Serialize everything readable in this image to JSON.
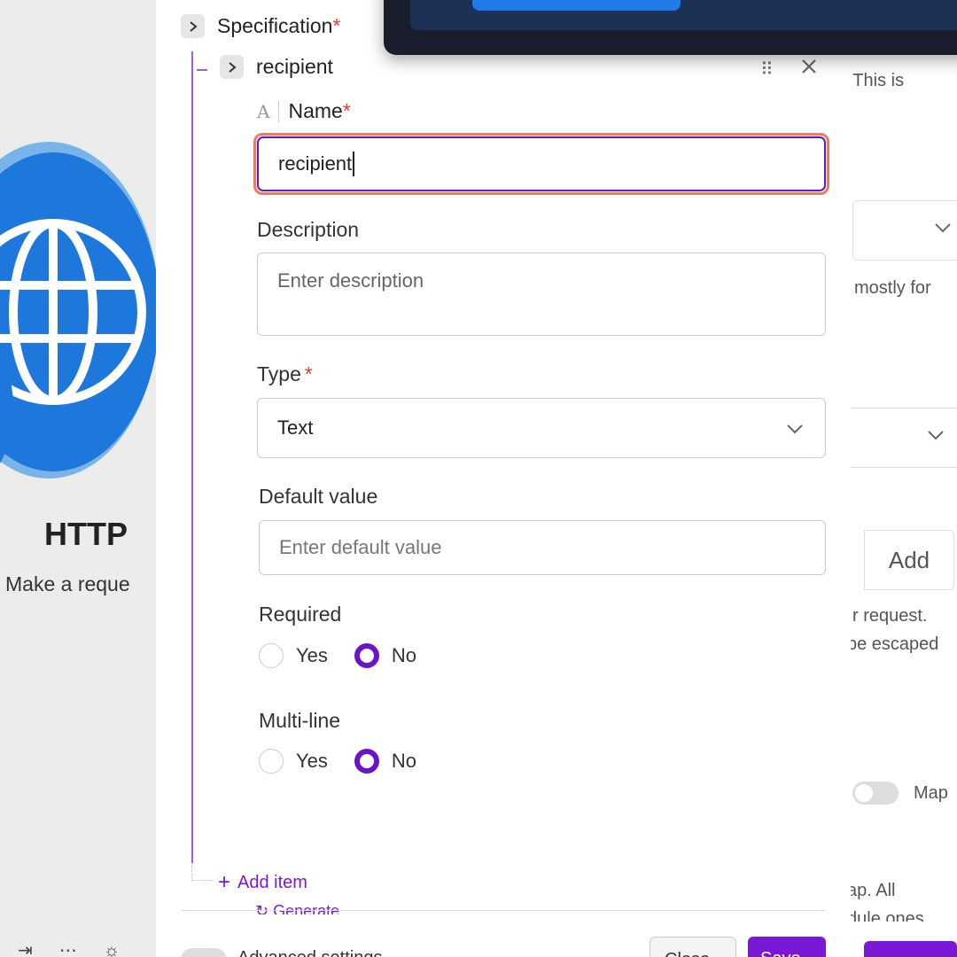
{
  "background": {
    "module_title": "HTTP",
    "module_subtitle": "Make a reque",
    "right_texts": {
      "t1": "t. This is",
      "t2": "mostly for",
      "t3": "r request.",
      "t4": "be escaped",
      "t5": "Map",
      "t6": "ap. All",
      "t7": "dule ones"
    },
    "add_button": "Add"
  },
  "specification": {
    "label": "Specification",
    "required_mark": "*"
  },
  "item": {
    "name": "recipient"
  },
  "form": {
    "name": {
      "label": "Name",
      "required_mark": "*",
      "value": "recipient"
    },
    "description": {
      "label": "Description",
      "placeholder": "Enter description"
    },
    "type": {
      "label": "Type",
      "required_mark": "*",
      "selected": "Text"
    },
    "default_value": {
      "label": "Default value",
      "placeholder": "Enter default value"
    },
    "required": {
      "label": "Required",
      "options": [
        "Yes",
        "No"
      ],
      "selected": "No"
    },
    "multiline": {
      "label": "Multi-line",
      "options": [
        "Yes",
        "No"
      ],
      "selected": "No"
    }
  },
  "actions": {
    "add_item": "Add item",
    "generate": "Generate",
    "advanced_settings": "Advanced settings",
    "close": "Close",
    "save": "Save"
  },
  "colors": {
    "accent": "#6a14c8",
    "focus_ring": "#f07a5c",
    "required": "#e03a3a"
  }
}
